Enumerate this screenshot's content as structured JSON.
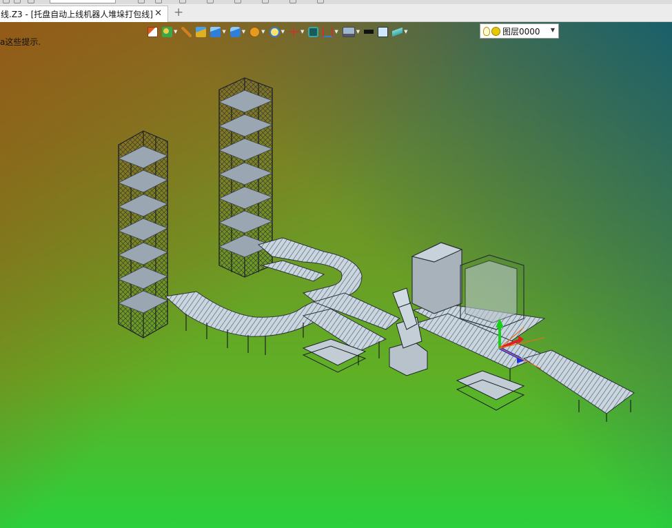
{
  "window": {
    "tab_title": "线.Z3 - [托盘自动上线机器人堆垛打包线]",
    "tab_close": "✕",
    "tab_add": "+"
  },
  "viewport": {
    "hint_text": "a这些提示."
  },
  "toolbar": {
    "items": [
      {
        "icon": "import-icon",
        "color": "#e05a20"
      },
      {
        "icon": "assembly-icon",
        "color": "#3aa84a"
      },
      {
        "icon": "pen-icon",
        "color": "#d08020"
      },
      {
        "icon": "part-icon",
        "color": "#e0b020"
      },
      {
        "icon": "solid-icon",
        "color": "#2f7fd8"
      },
      {
        "icon": "render-icon",
        "color": "#2f7fd8"
      },
      {
        "icon": "material-icon",
        "color": "#e89a20"
      },
      {
        "icon": "zoom-icon",
        "color": "#2f7fd8"
      },
      {
        "icon": "pivot-icon",
        "color": "#d03030"
      },
      {
        "icon": "view-icon",
        "color": "#3aa8a8"
      },
      {
        "icon": "section-icon",
        "color": "#d03030"
      },
      {
        "icon": "display-icon",
        "color": "#6a8aa8"
      },
      {
        "icon": "line-color-icon",
        "color": "#111111"
      },
      {
        "icon": "fill-color-icon",
        "color": "#cfe8ff"
      },
      {
        "icon": "layer-stack-icon",
        "color": "#3aa8a8"
      }
    ],
    "layer_name": "图层0000"
  }
}
